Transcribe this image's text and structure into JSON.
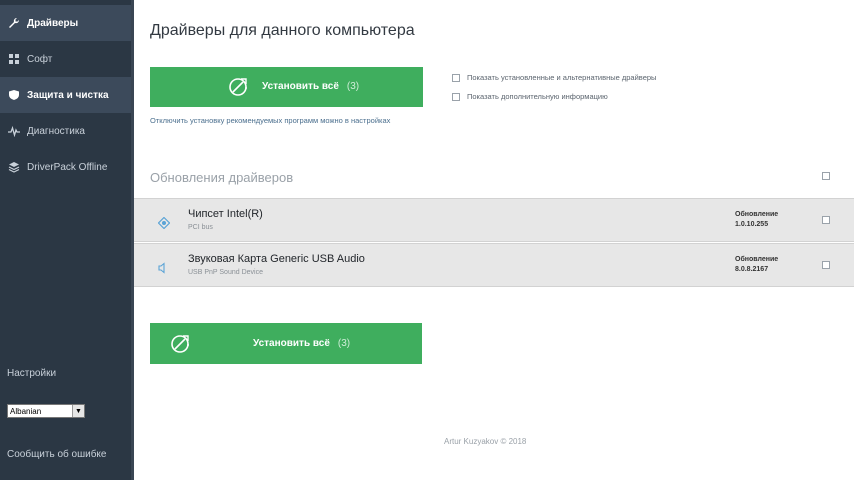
{
  "sidebar": {
    "items": [
      {
        "label": "Драйверы",
        "icon": "wrench-icon",
        "active": true
      },
      {
        "label": "Софт",
        "icon": "grid-icon",
        "active": false
      },
      {
        "label": "Защита и чистка",
        "icon": "shield-icon",
        "active": true
      },
      {
        "label": "Диагностика",
        "icon": "pulse-icon",
        "active": false
      },
      {
        "label": "DriverPack Offline",
        "icon": "layers-icon",
        "active": false
      }
    ],
    "settings_label": "Настройки",
    "language": "Albanian",
    "report_label": "Сообщить об ошибке"
  },
  "main": {
    "title": "Драйверы для данного компьютера",
    "install_label": "Установить всё",
    "install_count": "(3)",
    "disable_link": "Отключить установку рекомендуемых программ можно в настройках",
    "options": [
      "Показать установленные и альтернативные драйверы",
      "Показать дополнительную информацию"
    ],
    "section_title": "Обновления драйверов",
    "drivers": [
      {
        "name": "Чипсет Intel(R)",
        "sub": "PCI bus",
        "update_label": "Обновление",
        "version": "1.0.10.255",
        "icon": "chip-icon"
      },
      {
        "name": "Звуковая Карта Generic USB Audio",
        "sub": "USB PnP Sound Device",
        "update_label": "Обновление",
        "version": "8.0.8.2167",
        "icon": "speaker-icon"
      }
    ],
    "footer": "Artur Kuzyakov © 2018"
  },
  "colors": {
    "sidebar_bg": "#2b3744",
    "accent_green": "#3fae5e",
    "row_bg": "#e7e7e7"
  }
}
